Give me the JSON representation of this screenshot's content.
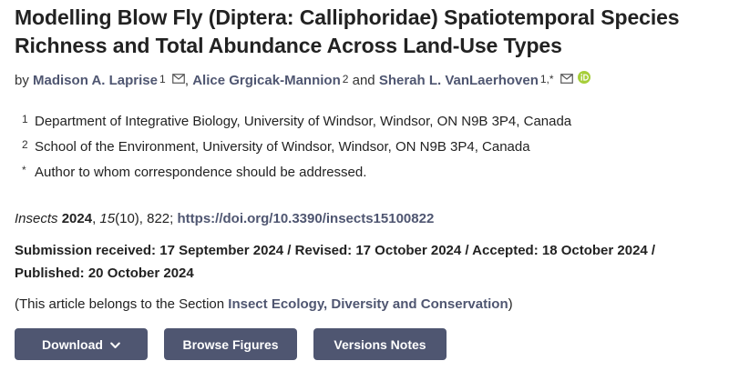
{
  "article": {
    "title": "Modelling Blow Fly (Diptera: Calliphoridae) Spatiotemporal Species Richness and Total Abundance Across Land-Use Types",
    "by_label": "by",
    "authors": [
      {
        "name": "Madison A. Laprise",
        "aff": "1"
      },
      {
        "name": "Alice Grgicak-Mannion",
        "aff": "2"
      },
      {
        "name": "Sherah L. VanLaerhoven",
        "aff": "1,*"
      }
    ],
    "separator_comma": ",",
    "separator_and": "and",
    "affiliations": [
      {
        "mark": "1",
        "text": "Department of Integrative Biology, University of Windsor, Windsor, ON N9B 3P4, Canada"
      },
      {
        "mark": "2",
        "text": "School of the Environment, University of Windsor, Windsor, ON N9B 3P4, Canada"
      },
      {
        "mark": "*",
        "text": "Author to whom correspondence should be addressed."
      }
    ],
    "citation": {
      "journal": "Insects",
      "year": "2024",
      "volume": "15",
      "issue_pages": "(10), 822;",
      "doi": "https://doi.org/10.3390/insects15100822"
    },
    "dates": "Submission received: 17 September 2024 / Revised: 17 October 2024 / Accepted: 18 October 2024 / Published: 20 October 2024",
    "section": {
      "prefix": "(This article belongs to the Section",
      "name": "Insect Ecology, Diversity and Conservation",
      "suffix": ")"
    }
  },
  "buttons": {
    "download": "Download",
    "figures": "Browse Figures",
    "versions": "Versions Notes"
  },
  "icons": {
    "mail": "mail-icon",
    "orcid": "orcid-icon",
    "chevron": "chevron-down-icon"
  },
  "colors": {
    "link": "#4f5671",
    "button_bg": "#4f5671",
    "orcid": "#a6ce39"
  }
}
